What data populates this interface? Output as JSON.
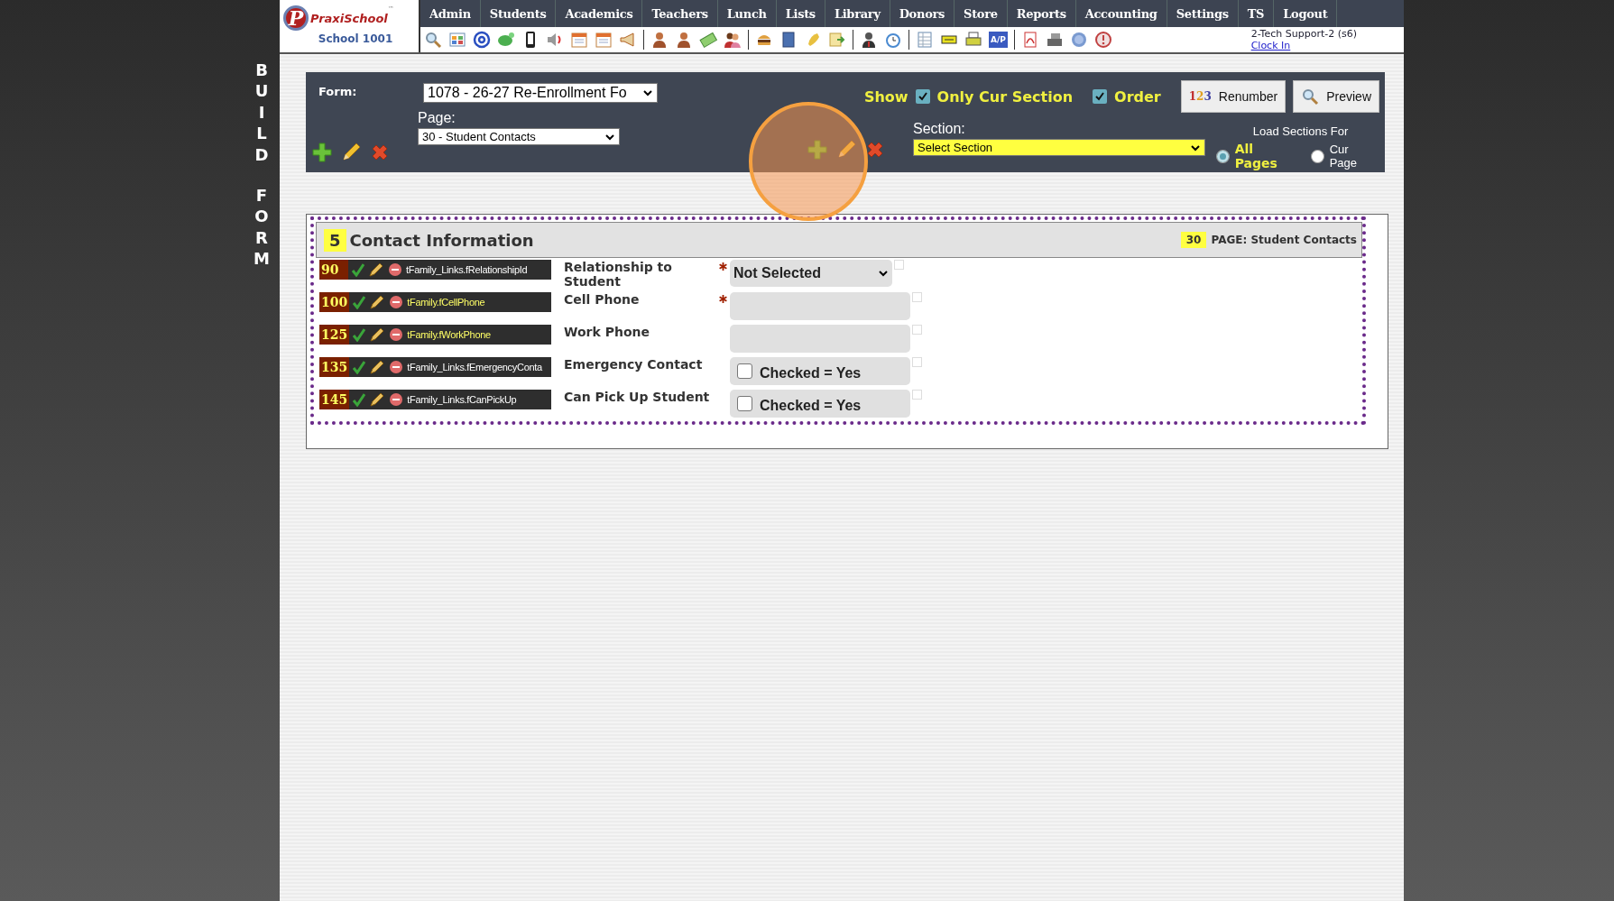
{
  "side_words": [
    "BUILD",
    "FORM"
  ],
  "logo": {
    "mark": "P",
    "name": "PraxiSchool",
    "tm": "™",
    "school": "School 1001"
  },
  "nav": [
    "Admin",
    "Students",
    "Academics",
    "Teachers",
    "Lunch",
    "Lists",
    "Library",
    "Donors",
    "Store",
    "Reports",
    "Accounting",
    "Settings",
    "TS",
    "Logout"
  ],
  "ap_label": "A/P",
  "user": {
    "name": "2-Tech Support-2 (s6)",
    "link": "Clock In"
  },
  "toolbar": {
    "form_label": "Form:",
    "form_value": "1078 - 26-27 Re-Enrollment Fo",
    "page_label": "Page:",
    "page_value": "30 - Student Contacts",
    "show_label": "Show",
    "options": [
      {
        "label": "Only Cur Section",
        "checked": true
      },
      {
        "label": "Order",
        "checked": true
      }
    ],
    "renumber_icon": "123",
    "renumber": "Renumber",
    "preview": "Preview",
    "section_label": "Section:",
    "section_value": "Select Section",
    "load_label": "Load Sections For",
    "load_options": [
      {
        "label": "All Pages",
        "selected": true
      },
      {
        "label": "Cur Page",
        "selected": false
      }
    ]
  },
  "section": {
    "number": "5",
    "title": "Contact Information",
    "page_number": "30",
    "page_title": "PAGE: Student Contacts",
    "rows": [
      {
        "order": "90",
        "field": "tFamily_Links.fRelationshipId",
        "color": "#ffffff",
        "label": "Relationship to Student",
        "required": true,
        "kind": "select",
        "value": "Not Selected"
      },
      {
        "order": "100",
        "field": "tFamily.fCellPhone",
        "color": "#ffff66",
        "label": "Cell Phone",
        "required": true,
        "kind": "text"
      },
      {
        "order": "125",
        "field": "tFamily.fWorkPhone",
        "color": "#ffff66",
        "label": "Work Phone",
        "required": false,
        "kind": "text"
      },
      {
        "order": "135",
        "field": "tFamily_Links.fEmergencyConta",
        "color": "#ffffff",
        "label": "Emergency Contact",
        "required": false,
        "kind": "checkbox",
        "value": "Checked = Yes",
        "checked": false
      },
      {
        "order": "145",
        "field": "tFamily_Links.fCanPickUp",
        "color": "#ffffff",
        "label": "Can Pick Up Student",
        "required": false,
        "kind": "checkbox",
        "value": "Checked = Yes",
        "checked": false
      }
    ]
  }
}
